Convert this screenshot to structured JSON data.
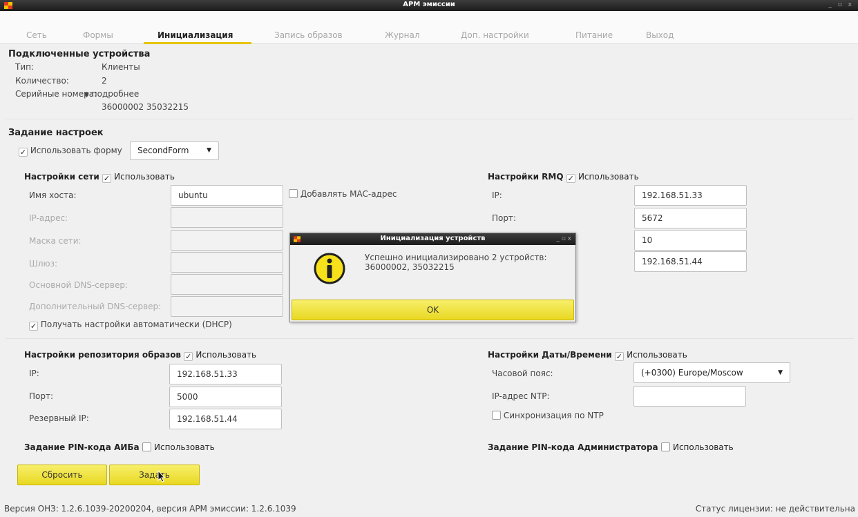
{
  "window": {
    "title": "АРМ эмиссии",
    "controls": "_ ▫ x"
  },
  "tabs": [
    {
      "label": "Сеть"
    },
    {
      "label": "Формы"
    },
    {
      "label": "Инициализация"
    },
    {
      "label": "Запись образов"
    },
    {
      "label": "Журнал"
    },
    {
      "label": "Доп. настройки"
    },
    {
      "label": "Питание"
    },
    {
      "label": "Выход"
    }
  ],
  "devices": {
    "heading": "Подключенные устройства",
    "type_label": "Тип:",
    "type_value": "Клиенты",
    "count_label": "Количество:",
    "count_value": "2",
    "serials_label": "Серийные номера:",
    "details_link": "подробнее",
    "serials_value": "36000002 35032215"
  },
  "settings": {
    "heading": "Задание настроек",
    "use_form_label": "Использовать форму",
    "form_value": "SecondForm"
  },
  "network": {
    "heading": "Настройки сети",
    "use_label": "Использовать",
    "hostname_label": "Имя хоста:",
    "hostname_value": "ubuntu",
    "add_mac_label": "Добавлять MAC-адрес",
    "ip_label": "IP-адрес:",
    "mask_label": "Маска сети:",
    "gateway_label": "Шлюз:",
    "dns1_label": "Основной DNS-сервер:",
    "dns2_label": "Дополнительный DNS-сервер:",
    "dhcp_label": "Получать настройки автоматически (DHCP)"
  },
  "rmq": {
    "heading": "Настройки RMQ",
    "use_label": "Использовать",
    "ip_label": "IP:",
    "ip_value": "192.168.51.33",
    "port_label": "Порт:",
    "port_value": "5672",
    "field3_value": "10",
    "field4_value": "192.168.51.44"
  },
  "repo": {
    "heading": "Настройки репозитория образов",
    "use_label": "Использовать",
    "ip_label": "IP:",
    "ip_value": "192.168.51.33",
    "port_label": "Порт:",
    "port_value": "5000",
    "backup_ip_label": "Резервный IP:",
    "backup_ip_value": "192.168.51.44"
  },
  "datetime": {
    "heading": "Настройки Даты/Времени",
    "use_label": "Использовать",
    "tz_label": "Часовой пояс:",
    "tz_value": "(+0300) Europe/Moscow",
    "ntp_label": "IP-адрес NTP:",
    "sync_label": "Синхронизация по NTP"
  },
  "pin_aiba": {
    "heading": "Задание PIN-кода АИБа",
    "use_label": "Использовать"
  },
  "pin_admin": {
    "heading": "Задание PIN-кода Администратора",
    "use_label": "Использовать"
  },
  "buttons": {
    "reset": "Сбросить",
    "apply": "Задать"
  },
  "status": {
    "version": "Версия ОНЗ: 1.2.6.1039-20200204, версия АРМ эмиссии: 1.2.6.1039",
    "license": "Статус лицензии: не действительна"
  },
  "dialog": {
    "title": "Инициализация устройств",
    "controls": "_ ▫ x",
    "message_line1": "Успешно инициализировано 2 устройств:",
    "message_line2": "36000002, 35032215",
    "ok": "OK"
  },
  "colors": {
    "accent": "#e6c400",
    "button": "#f2e43c"
  },
  "icons": {
    "info": "info-icon",
    "app": "app-icon",
    "checkmark": "checkmark-icon",
    "dropdown": "chevron-down-icon",
    "cursor": "mouse-cursor-icon"
  }
}
